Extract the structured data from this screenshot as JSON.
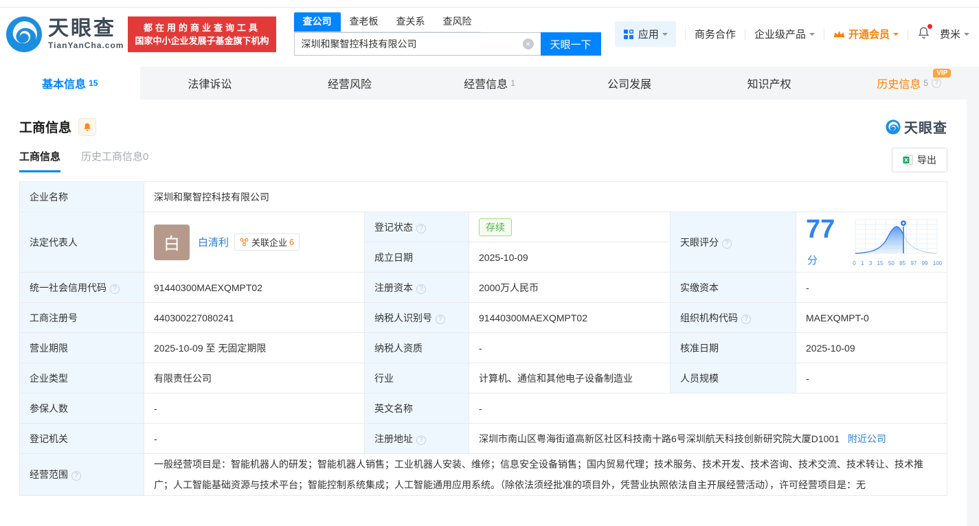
{
  "brand": {
    "name": "天眼查",
    "domain": "TianYanCha.com",
    "slogan_line1": "都在用的商业查询工具",
    "slogan_line2": "国家中小企业发展子基金旗下机构"
  },
  "header": {
    "search": {
      "tabs": [
        {
          "label": "查公司",
          "active": true
        },
        {
          "label": "查老板",
          "active": false
        },
        {
          "label": "查关系",
          "active": false
        },
        {
          "label": "查风险",
          "active": false
        }
      ],
      "value": "深圳和聚智控科技有限公司",
      "button": "天眼一下"
    },
    "nav": {
      "apps": "应用",
      "cooperation": "商务合作",
      "enterprise": "企业级产品",
      "member": "开通会员",
      "user": "费米"
    }
  },
  "nav_tabs": [
    {
      "label": "基本信息",
      "count": "15",
      "state": "active"
    },
    {
      "label": "法律诉讼",
      "count": ""
    },
    {
      "label": "经营风险",
      "count": ""
    },
    {
      "label": "经营信息",
      "count": "1"
    },
    {
      "label": "公司发展",
      "count": ""
    },
    {
      "label": "知识产权",
      "count": ""
    },
    {
      "label": "历史信息",
      "count": "5",
      "state": "history",
      "vip": true,
      "help": true
    }
  ],
  "vip_text": "VIP",
  "section": {
    "title": "工商信息",
    "subtabs": [
      {
        "label": "工商信息",
        "active": true
      },
      {
        "label": "历史工商信息0",
        "active": false
      }
    ],
    "export_label": "导出",
    "watermark": "天眼查"
  },
  "biz": {
    "name_label": "企业名称",
    "name": "深圳和聚智控科技有限公司",
    "legal_label": "法定代表人",
    "legal_avatar": "白",
    "legal_name": "白清利",
    "related": "关联企业",
    "related_n": "6",
    "status_label": "登记状态",
    "status": "存续",
    "estab_label": "成立日期",
    "estab": "2025-10-09",
    "credit_label": "统一社会信用代码",
    "credit": "91440300MAEXQMPT02",
    "regcap_label": "注册资本",
    "regcap": "2000万人民币",
    "paidcap_label": "实缴资本",
    "paidcap": "-",
    "regno_label": "工商注册号",
    "regno": "440300227080241",
    "taxid_label": "纳税人识别号",
    "taxid": "91440300MAEXQMPT02",
    "orgcode_label": "组织机构代码",
    "orgcode": "MAEXQMPT-0",
    "term_label": "营业期限",
    "term": "2025-10-09 至 无固定期限",
    "taxqual_label": "纳税人资质",
    "taxqual": "-",
    "approve_label": "核准日期",
    "approve": "2025-10-09",
    "type_label": "企业类型",
    "type": "有限责任公司",
    "industry_label": "行业",
    "industry": "计算机、通信和其他电子设备制造业",
    "staff_label": "人员规模",
    "staff": "-",
    "insured_label": "参保人数",
    "insured": "-",
    "engname_label": "英文名称",
    "engname": "-",
    "regauth_label": "登记机关",
    "regauth": "-",
    "address_label": "注册地址",
    "address": "深圳市南山区粤海街道高新区社区科技南十路6号深圳航天科技创新研究院大厦D1001",
    "nearby": "附近公司",
    "scope_label": "经营范围",
    "scope": "一般经营项目是：智能机器人的研发；智能机器人销售；工业机器人安装、维修；信息安全设备销售；国内贸易代理；技术服务、技术开发、技术咨询、技术交流、技术转让、技术推广；人工智能基础资源与技术平台；智能控制系统集成；人工智能通用应用系统。（除依法须经批准的项目外，凭营业执照依法自主开展经营活动），许可经营项目是：无"
  },
  "score": {
    "label": "天眼评分",
    "value": "77",
    "unit": "分",
    "axis_ticks": [
      "0",
      "1",
      "3",
      "15",
      "50",
      "85",
      "97",
      "99",
      "100"
    ]
  },
  "colors": {
    "primary_blue": "#0084ff",
    "link_blue": "#2b7fd3",
    "orange": "#ff8000",
    "red_banner": "#e23a38",
    "status_green": "#52b152",
    "label_cell_bg": "#eef7fe"
  }
}
